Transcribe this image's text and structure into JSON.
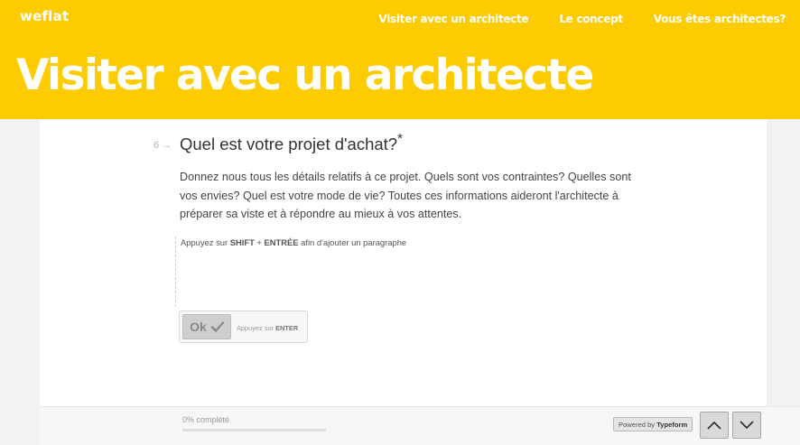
{
  "header": {
    "logo_text": "weflat",
    "nav": [
      {
        "label": "Visiter avec un architecte"
      },
      {
        "label": "Le concept"
      },
      {
        "label": "Vous êtes architectes?"
      }
    ],
    "hero_title": "Visiter avec un architecte",
    "brand_color": "#fccb00"
  },
  "question": {
    "number": "6",
    "arrow": "→",
    "title": "Quel est votre projet d'achat?",
    "required_mark": "*",
    "description": "Donnez nous tous les détails relatifs à ce projet. Quels sont vos contraintes? Quelles sont vos envies? Quel est votre mode de vie? Toutes ces informations aideront l'architecte à préparer sa viste et à répondre au mieux à vos attentes.",
    "hint_prefix": "Appuyez sur ",
    "hint_key1": "SHIFT",
    "hint_plus": " + ",
    "hint_key2": "ENTRÉE",
    "hint_suffix": " afin d'ajouter un paragraphe",
    "answer_value": ""
  },
  "ok_button": {
    "label": "Ok",
    "icon": "check-icon",
    "hint_prefix": "Appuyez sur ",
    "hint_key": "ENTER"
  },
  "footer": {
    "progress_text": "0% complété",
    "progress_fraction": 0,
    "powered_prefix": "Powered by ",
    "powered_brand": "Typeform",
    "prev_icon": "chevron-up-icon",
    "next_icon": "chevron-down-icon"
  }
}
